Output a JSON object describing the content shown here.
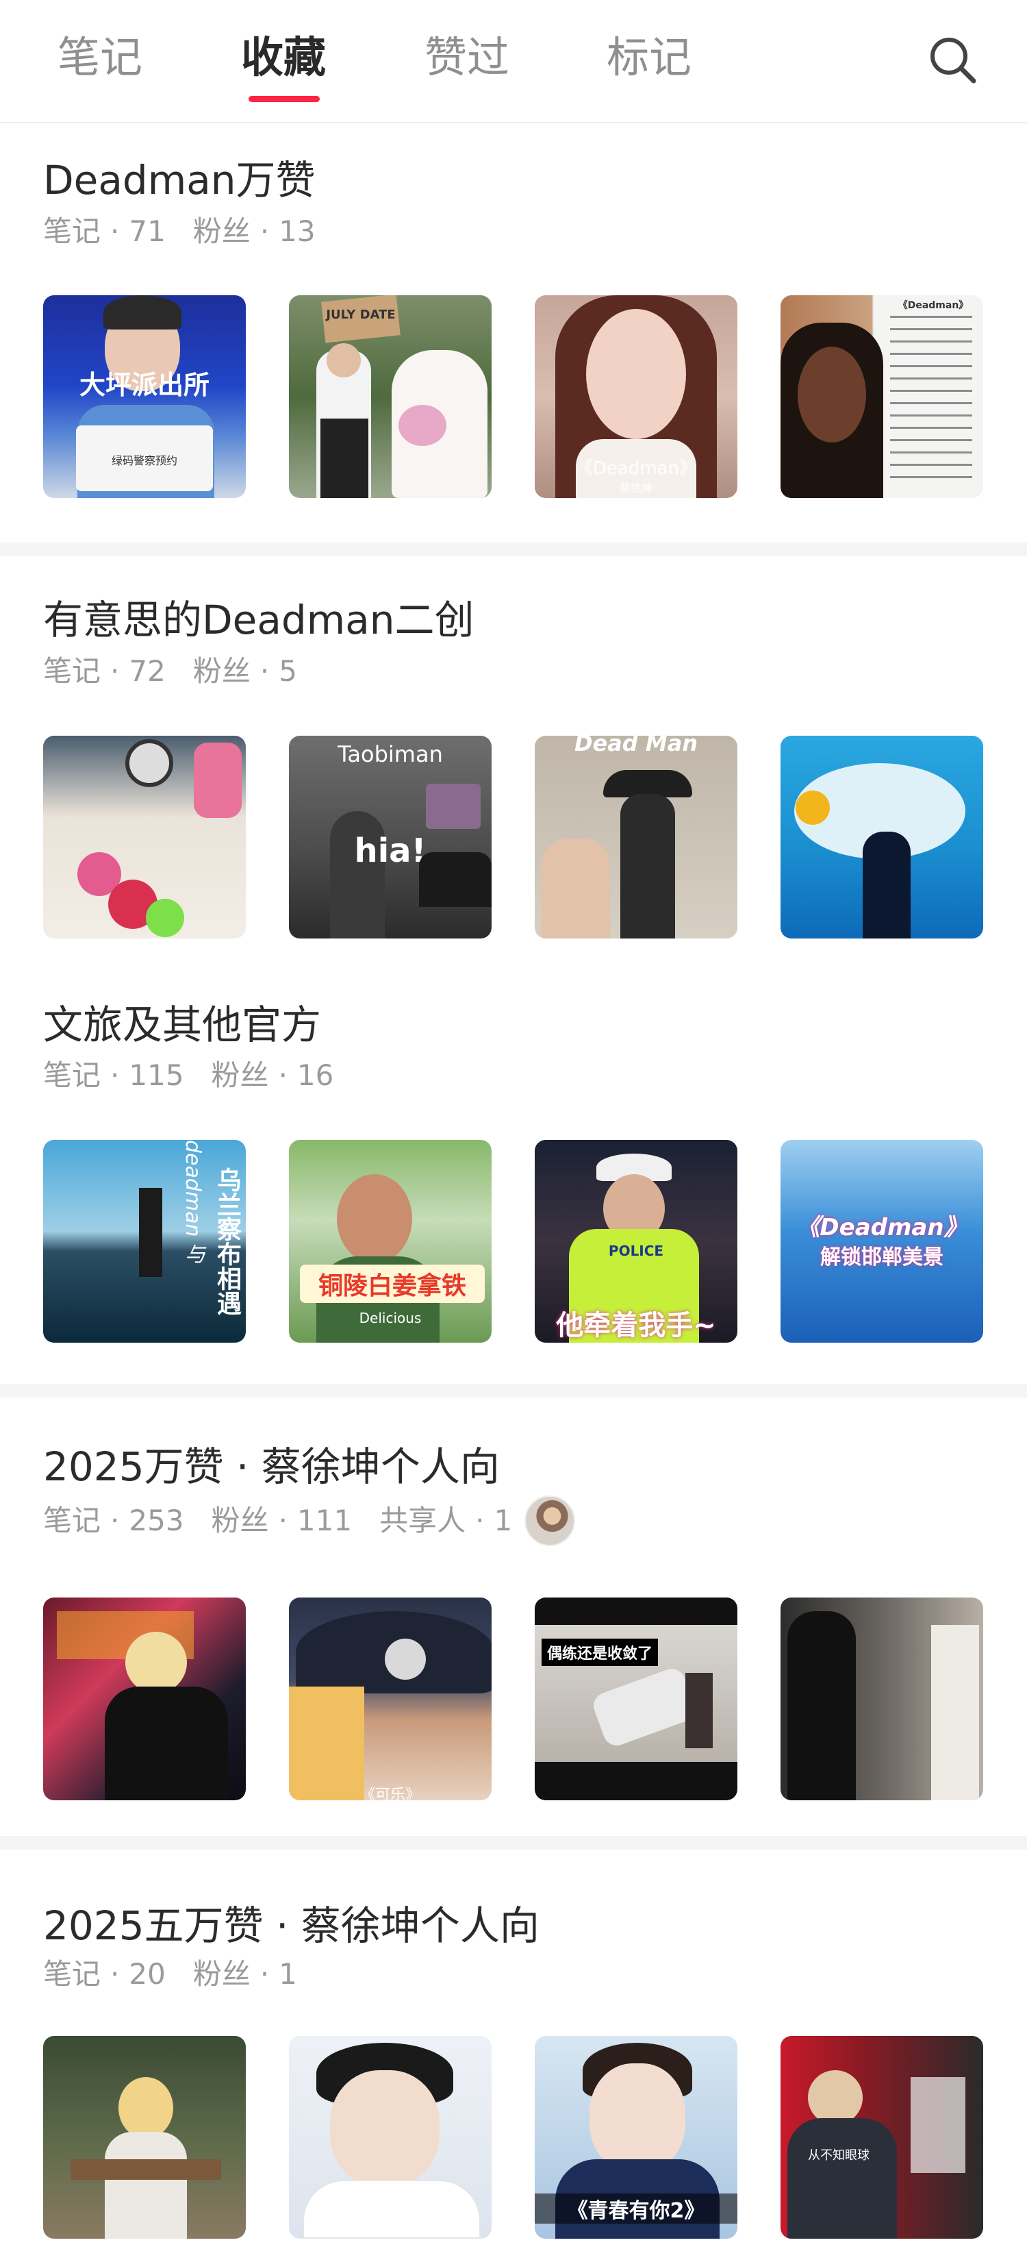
{
  "tabs": [
    {
      "label": "笔记",
      "active": false
    },
    {
      "label": "收藏",
      "active": true
    },
    {
      "label": "赞过",
      "active": false
    },
    {
      "label": "标记",
      "active": false
    }
  ],
  "accent_color": "#ff2442",
  "icons": {
    "search": "search-icon"
  },
  "boards": [
    {
      "title": "Deadman万赞",
      "notes_label": "笔记",
      "notes": "71",
      "fans_label": "粉丝",
      "fans": "13",
      "thumbs": [
        {
          "caption": "大坪派出所",
          "sub": "绿码警察预约"
        },
        {
          "caption": "JULY DATE",
          "sub": ""
        },
        {
          "caption": "《Deadman》",
          "sub": "蔡徐坤"
        },
        {
          "caption": "《Deadman》",
          "sub": ""
        }
      ]
    },
    {
      "title": "有意思的Deadman二创",
      "notes_label": "笔记",
      "notes": "72",
      "fans_label": "粉丝",
      "fans": "5",
      "thumbs": [
        {
          "caption": "",
          "sub": ""
        },
        {
          "caption": "Taobiman",
          "sub": "hia!"
        },
        {
          "caption": "Dead Man",
          "sub": ""
        },
        {
          "caption": "",
          "sub": ""
        }
      ]
    },
    {
      "title": "文旅及其他官方",
      "notes_label": "笔记",
      "notes": "115",
      "fans_label": "粉丝",
      "fans": "16",
      "thumbs": [
        {
          "caption": "乌兰察布相遇",
          "sub": "deadman 与"
        },
        {
          "caption": "铜陵白姜拿铁",
          "sub": "Delicious"
        },
        {
          "caption": "他牵着我手~",
          "sub": "POLICE"
        },
        {
          "caption": "《Deadman》",
          "sub": "解锁邯郸美景"
        }
      ]
    },
    {
      "title": "2025万赞 · 蔡徐坤个人向",
      "notes_label": "笔记",
      "notes": "253",
      "fans_label": "粉丝",
      "fans": "111",
      "share_label": "共享人",
      "share": "1",
      "thumbs": [
        {
          "caption": "",
          "sub": ""
        },
        {
          "caption": "",
          "sub": "《可乐》"
        },
        {
          "caption": "偶练还是收敛了",
          "sub": ""
        },
        {
          "caption": "",
          "sub": ""
        }
      ]
    },
    {
      "title": "2025五万赞 · 蔡徐坤个人向",
      "notes_label": "笔记",
      "notes": "20",
      "fans_label": "粉丝",
      "fans": "1",
      "thumbs": [
        {
          "caption": "",
          "sub": ""
        },
        {
          "caption": "",
          "sub": ""
        },
        {
          "caption": "《青春有你2》",
          "sub": ""
        },
        {
          "caption": "",
          "sub": "从不知眼球"
        }
      ]
    }
  ]
}
